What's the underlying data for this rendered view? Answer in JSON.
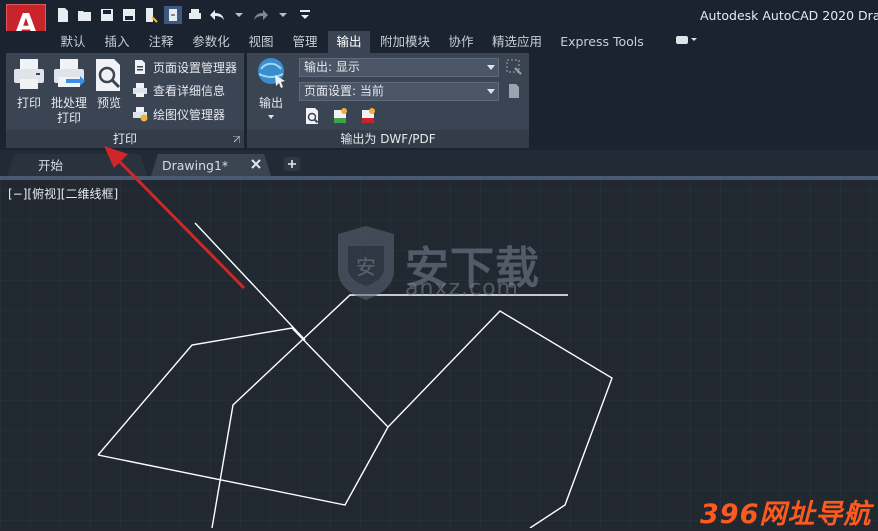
{
  "app": {
    "title": "Autodesk AutoCAD 2020  Dra",
    "logo_letter": "A"
  },
  "ribbon_tabs": [
    {
      "label": "默认"
    },
    {
      "label": "插入"
    },
    {
      "label": "注释"
    },
    {
      "label": "参数化"
    },
    {
      "label": "视图"
    },
    {
      "label": "管理"
    },
    {
      "label": "输出",
      "active": true
    },
    {
      "label": "附加模块"
    },
    {
      "label": "协作"
    },
    {
      "label": "精选应用"
    },
    {
      "label": "Express Tools"
    }
  ],
  "print_panel": {
    "title": "打印",
    "print_label": "打印",
    "batch_label_1": "批处理",
    "batch_label_2": "打印",
    "preview_label": "预览",
    "page_setup_manager": "页面设置管理器",
    "view_details": "查看详细信息",
    "plotter_manager": "绘图仪管理器"
  },
  "export_panel": {
    "title": "输出为 DWF/PDF",
    "export_label": "输出",
    "export_combo": "输出: 显示",
    "page_setup_combo": "页面设置: 当前"
  },
  "doc_tabs": {
    "start": "开始",
    "drawing": "Drawing1*"
  },
  "viewport_label": "[−][俯视][二维线框]",
  "watermarks": {
    "center_cn": "安下载",
    "center_en": "anxz.com",
    "corner": "396网址导航"
  },
  "colors": {
    "accent_red": "#c8242b",
    "ribbon_bg": "#3b4453",
    "canvas_bg": "#212830",
    "annotation_arrow": "#d0262a"
  }
}
